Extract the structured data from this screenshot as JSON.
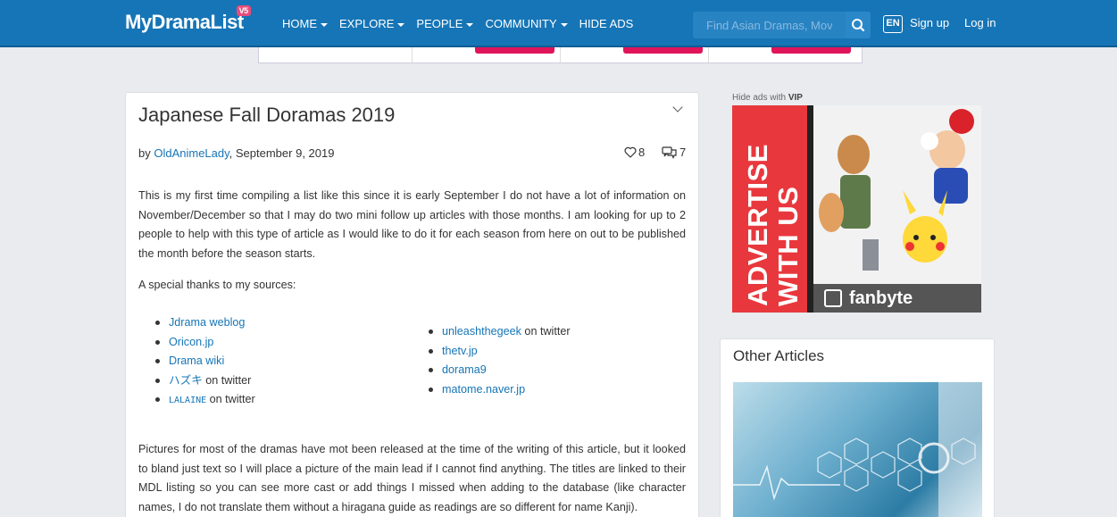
{
  "nav": {
    "logo": "MyDramaList",
    "logo_badge": "V5",
    "items": [
      {
        "label": "HOME"
      },
      {
        "label": "EXPLORE"
      },
      {
        "label": "PEOPLE"
      },
      {
        "label": "COMMUNITY"
      },
      {
        "label": "HIDE ADS"
      }
    ],
    "search_placeholder": "Find Asian Dramas, Movies",
    "lang": "EN",
    "signup": "Sign up",
    "login": "Log in"
  },
  "article": {
    "title": "Japanese Fall Doramas 2019",
    "by": "by ",
    "author": "OldAnimeLady",
    "date": ", September 9, 2019",
    "likes": "8",
    "comments": "7",
    "p1": "This is my first time compiling a list like this since it is early September I do not have a lot of information on November/December so that I may do two mini follow up articles with those months. I am looking for up to 2 people to help with this type of article as I would like to do it for each season from here on out to be published the month before the season starts.",
    "p2": "A special thanks to my sources:",
    "sources_left": [
      {
        "link": "Jdrama weblog",
        "suffix": ""
      },
      {
        "link": "Oricon.jp",
        "suffix": ""
      },
      {
        "link": "Drama wiki",
        "suffix": ""
      },
      {
        "link": "ハズキ",
        "suffix": " on twitter"
      },
      {
        "link": "LALAINE",
        "suffix": " on twitter"
      }
    ],
    "sources_right": [
      {
        "link": "unleashthegeek",
        "suffix": " on twitter"
      },
      {
        "link": "thetv.jp",
        "suffix": ""
      },
      {
        "link": "dorama9",
        "suffix": ""
      },
      {
        "link": "matome.naver.jp",
        "suffix": ""
      }
    ],
    "p3": "Pictures for most of the dramas have mot been released at the time of the writing of this article, but it looked to bland just text so I will place a picture of the main lead if I cannot find anything. The titles are linked to their MDL listing so you can see more cast or add things I missed when adding to the database (like character names, I do not translate them without a hiragana guide as readings are so different for name Kanji)."
  },
  "sidebar": {
    "hide_ads": "Hide ads with ",
    "hide_ads_vip": "VIP",
    "ad_text_1": "ADVERTISE",
    "ad_text_2": "WITH US",
    "ad_brand": "fanbyte",
    "other_articles_title": "Other Articles"
  },
  "colors": {
    "brand": "#1675b6",
    "ad_red": "#e8383d",
    "ad_pink": "#e0145a"
  }
}
